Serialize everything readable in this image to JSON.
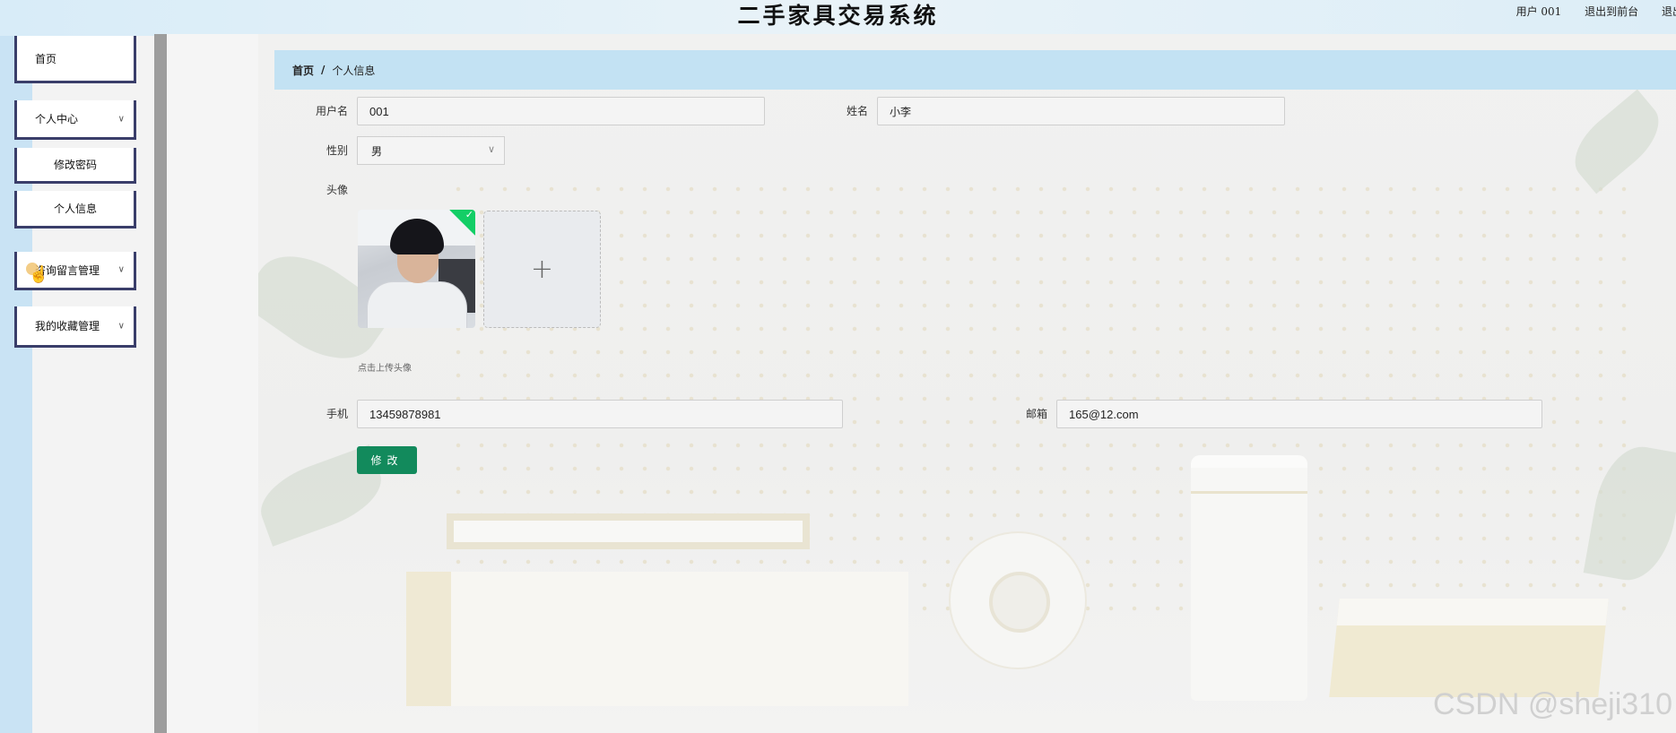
{
  "header": {
    "title": "二手家具交易系统",
    "user_label": "用户 001",
    "back_front": "退出到前台",
    "logout": "退出登"
  },
  "sidebar": {
    "items": [
      {
        "label": "首页",
        "has_chevron": false
      },
      {
        "label": "个人中心",
        "has_chevron": true
      },
      {
        "label": "修改密码",
        "sub": true
      },
      {
        "label": "个人信息",
        "sub": true
      },
      {
        "label": "咨询留言管理",
        "has_chevron": true
      },
      {
        "label": "我的收藏管理",
        "has_chevron": true
      }
    ]
  },
  "breadcrumb": {
    "home": "首页",
    "separator": "/",
    "current": "个人信息"
  },
  "form": {
    "username_label": "用户名",
    "username_value": "001",
    "name_label": "姓名",
    "name_value": "小李",
    "gender_label": "性别",
    "gender_value": "男",
    "avatar_label": "头像",
    "upload_plus": "+",
    "upload_hint": "点击上传头像",
    "phone_label": "手机",
    "phone_value": "13459878981",
    "email_label": "邮箱",
    "email_value": "165@12.com",
    "submit_label": "修改"
  },
  "watermark": "CSDN @sheji310",
  "colors": {
    "primary_button": "#128a5c",
    "breadcrumb_bg": "#c3e2f3",
    "menu_border": "#3a3e6a",
    "upload_success": "#13ce66"
  }
}
